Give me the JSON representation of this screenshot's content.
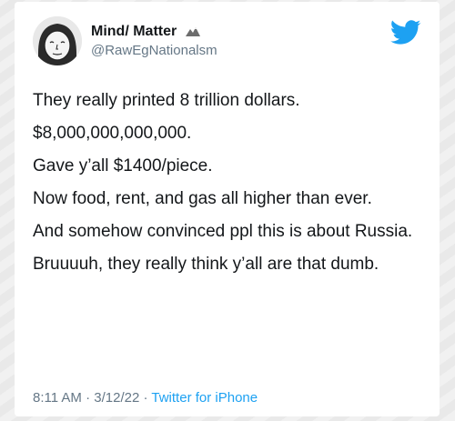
{
  "tweet": {
    "display_name": "Mind/ Matter",
    "handle": "@RawEgNationalsm",
    "paragraphs": [
      "They really printed 8 trillion dollars.",
      "$8,000,000,000,000.",
      "Gave y’all $1400/piece.",
      "Now food, rent, and gas all higher than ever.",
      "And somehow convinced ppl this is about Russia.",
      "Bruuuuh, they really think y’all are that dumb."
    ],
    "time": "8:11 AM",
    "date": "3/12/22",
    "source": "Twitter for iPhone",
    "separator": "·"
  },
  "colors": {
    "brand": "#1da1f2",
    "text": "#14171a",
    "muted": "#657786"
  },
  "icons": {
    "avatar": "wojak-avatar",
    "logo": "twitter-bird-icon"
  }
}
